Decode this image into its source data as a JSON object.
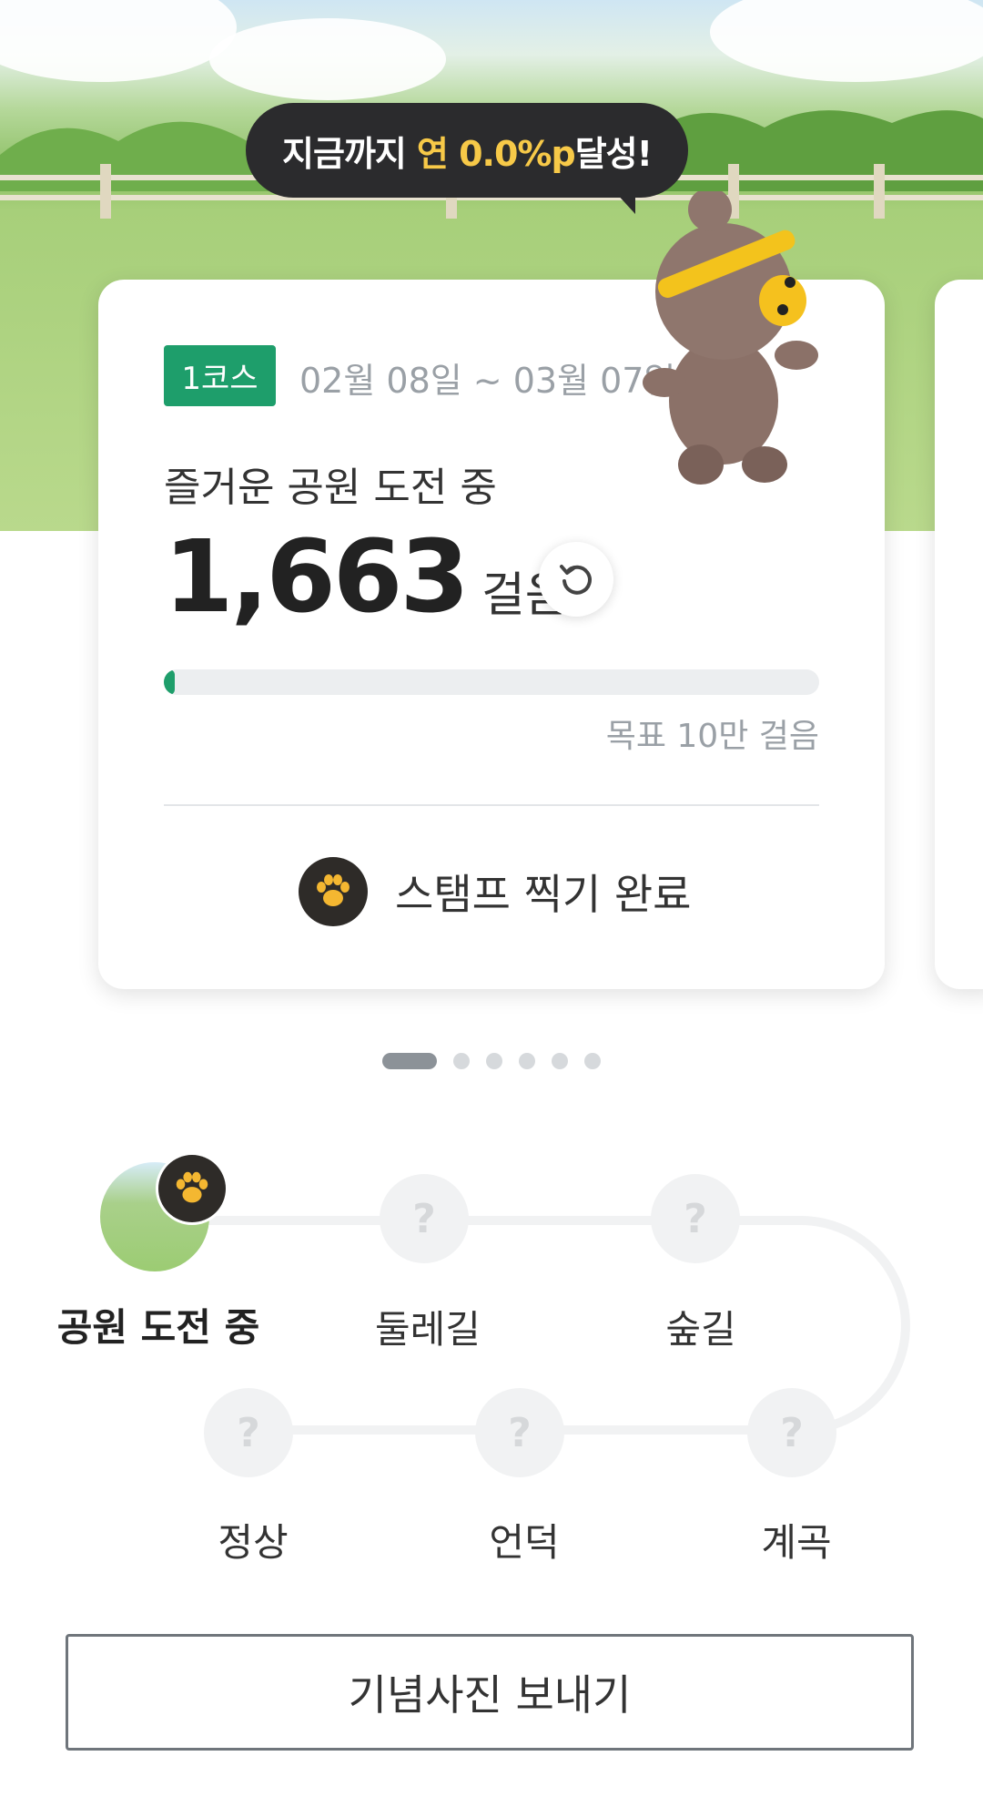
{
  "banner": {
    "prefix": "지금까지",
    "highlight": "연 0.0%p",
    "suffix": "달성!",
    "highlight_color": "#f7c948"
  },
  "card": {
    "course_badge": "1코스",
    "period": "02월 08일 ~ 03월 07일",
    "title": "즐거운 공원 도전 중",
    "steps": "1,663",
    "steps_unit": "걸음",
    "progress_fraction": 0.0166,
    "goal": "목표 10만 걸음",
    "stamp_label": "스탬프 찍기 완료",
    "accent": "#1e9e6b"
  },
  "pager": {
    "count": 6,
    "active_index": 0
  },
  "course_path": {
    "stops": [
      {
        "label": "공원 도전 중",
        "status": "current"
      },
      {
        "label": "둘레길",
        "status": "locked",
        "mark": "?"
      },
      {
        "label": "숲길",
        "status": "locked",
        "mark": "?"
      },
      {
        "label": "계곡",
        "status": "locked",
        "mark": "?"
      },
      {
        "label": "언덕",
        "status": "locked",
        "mark": "?"
      },
      {
        "label": "정상",
        "status": "locked",
        "mark": "?"
      }
    ]
  },
  "actions": {
    "send_photo": "기념사진 보내기"
  }
}
